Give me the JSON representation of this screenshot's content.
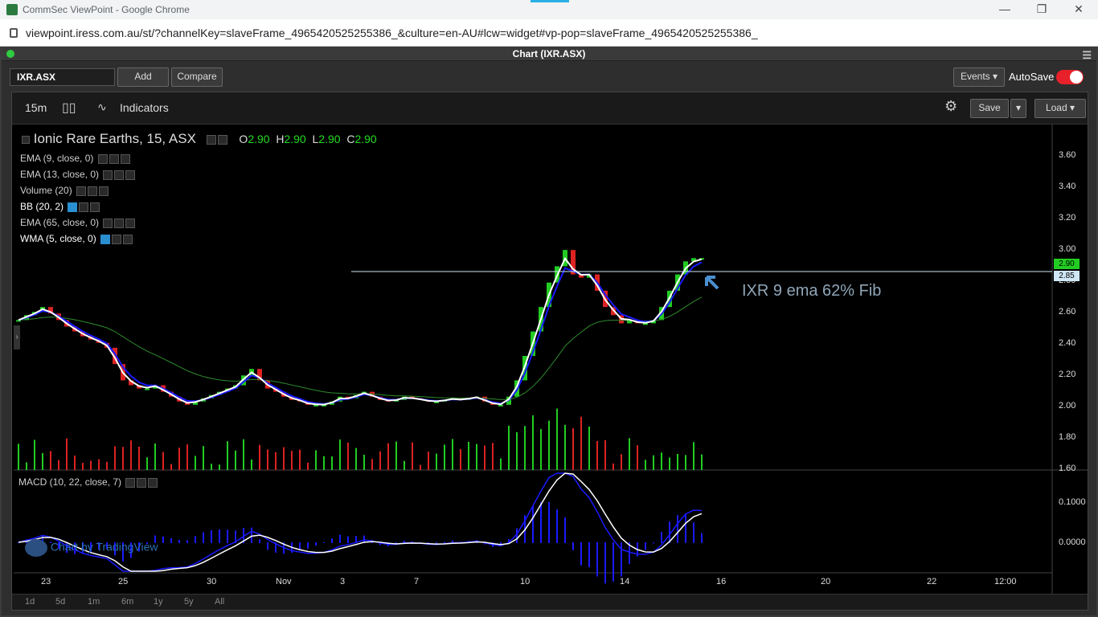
{
  "browser": {
    "tab_title": "CommSec ViewPoint - Google Chrome",
    "url": "viewpoint.iress.com.au/st/?channelKey=slaveFrame_4965420525255386_&culture=en-AU#lcw=widget#vp-pop=slaveFrame_4965420525255386_"
  },
  "panel": {
    "title": "Chart (IXR.ASX)"
  },
  "toolbar": {
    "symbol": "IXR.ASX",
    "add_label": "Add",
    "compare_label": "Compare",
    "events_label": "Events",
    "autosave_label": "AutoSave"
  },
  "chart_toolbar": {
    "interval": "15m",
    "indicators_label": "Indicators",
    "save_label": "Save",
    "load_label": "Load"
  },
  "legend": {
    "title": "Ionic Rare Earths, 15, ASX",
    "o_label": "O",
    "o_value": "2.90",
    "h_label": "H",
    "h_value": "2.90",
    "l_label": "L",
    "l_value": "2.90",
    "c_label": "C",
    "c_value": "2.90",
    "studies": [
      "EMA (9, close, 0)",
      "EMA (13, close, 0)",
      "Volume (20)",
      "BB (20, 2)",
      "EMA (65, close, 0)",
      "WMA (5, close, 0)"
    ],
    "macd": "MACD (10, 22, close, 7)"
  },
  "annotation": "IXR 9 ema 62% Fib",
  "watermark": "Chart by TradingView",
  "price_axis": [
    "3.60",
    "3.40",
    "3.20",
    "3.00",
    "2.80",
    "2.60",
    "2.40",
    "2.20",
    "2.00",
    "1.80",
    "1.60"
  ],
  "price_badges": {
    "last": "2.90",
    "line": "2.85"
  },
  "macd_axis": [
    "0.1000",
    "0.0000"
  ],
  "time_axis": [
    "23",
    "25",
    "30",
    "Nov",
    "3",
    "7",
    "10",
    "14",
    "16",
    "20",
    "22",
    "12:00"
  ],
  "periods": [
    "1d",
    "5d",
    "1m",
    "6m",
    "1y",
    "5y",
    "All"
  ],
  "colors": {
    "up": "#22cc22",
    "down": "#dd2222",
    "ema9": "#1a1aff",
    "wma5": "#ffffff",
    "ema65": "#2e8b2e",
    "accent": "#e8202a"
  },
  "chart_data": {
    "type": "candlestick",
    "horizontal_line": 2.85,
    "ylim": [
      1.6,
      3.7
    ],
    "close": [
      2.52,
      2.55,
      2.57,
      2.6,
      2.56,
      2.52,
      2.48,
      2.45,
      2.42,
      2.4,
      2.38,
      2.35,
      2.25,
      2.15,
      2.12,
      2.1,
      2.1,
      2.12,
      2.08,
      2.05,
      2.02,
      2.0,
      2.02,
      2.04,
      2.06,
      2.08,
      2.1,
      2.12,
      2.18,
      2.22,
      2.15,
      2.1,
      2.08,
      2.05,
      2.03,
      2.02,
      2.0,
      2.0,
      2.0,
      2.02,
      2.05,
      2.04,
      2.06,
      2.08,
      2.05,
      2.03,
      2.02,
      2.03,
      2.05,
      2.04,
      2.03,
      2.02,
      2.02,
      2.03,
      2.04,
      2.03,
      2.04,
      2.05,
      2.02,
      2.0,
      2.0,
      2.05,
      2.15,
      2.3,
      2.45,
      2.6,
      2.75,
      2.85,
      2.95,
      2.8,
      2.78,
      2.8,
      2.7,
      2.6,
      2.55,
      2.5,
      2.52,
      2.5,
      2.5,
      2.52,
      2.6,
      2.7,
      2.8,
      2.88,
      2.9,
      2.9
    ],
    "volume_max": 100,
    "macd_range": [
      -0.05,
      0.12
    ]
  }
}
